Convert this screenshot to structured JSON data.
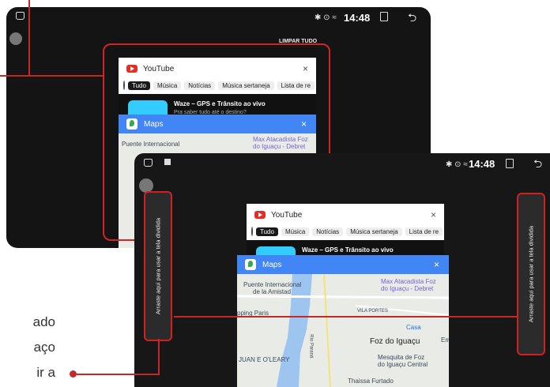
{
  "back_screen": {
    "clock": "14:48",
    "status_symbols": "✱ ⊙ ≈",
    "clear_all": "LIMPAR TUDO"
  },
  "youtube_card": {
    "title": "YouTube",
    "close": "×",
    "chips": [
      "Tudo",
      "Música",
      "Notícias",
      "Música sertaneja",
      "Lista de re"
    ],
    "waze_title": "Waze – GPS e Trânsito ao vivo",
    "waze_sub": "Pra saber tudo até o destino?"
  },
  "maps_card": {
    "title": "Maps",
    "close": "×",
    "labels": {
      "puente": "Puente Internacional",
      "amistad": "de la Amistad",
      "max": "Max Atacadista Foz",
      "max2": "do Iguaçu - Debret",
      "vila": "VILA PORTES",
      "casa": "Casa",
      "foz": "Foz do Iguaçu",
      "juan": "JUAN E O'LEARY",
      "mesquita": "Mesquita de Foz",
      "mesquita2": "do Iguaçu Central",
      "rio": "Rio Paraná",
      "thaissa": "Thaissa Furtado",
      "ping": "pping Paris",
      "em": "Em"
    }
  },
  "front_screen": {
    "clock": "14:48",
    "status_symbols": "✱ ⊙ ≈",
    "drop_zone_text": "Arraste aqui para usar a tela dividida"
  },
  "side_caption": {
    "line1": "ado",
    "line2": "aço",
    "line3": "ir a"
  },
  "colors": {
    "annotation_red": "#d42323",
    "maps_blue": "#4285f4",
    "youtube_red": "#e52d27"
  }
}
